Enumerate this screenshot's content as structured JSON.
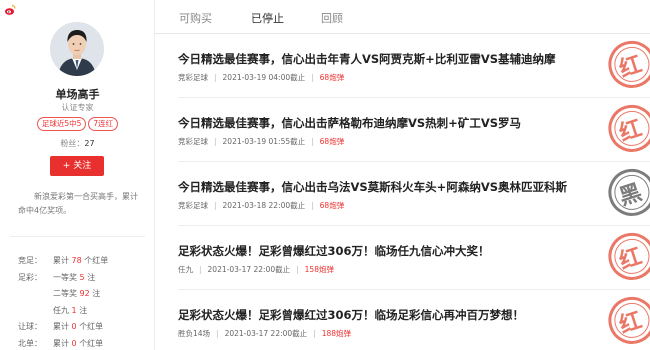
{
  "profile": {
    "name": "单场高手",
    "verify": "认证专家",
    "tags": [
      "足球近5中5",
      "7连红"
    ],
    "fans_label": "粉丝：",
    "fans_count": "27",
    "follow_label": "+ 关注",
    "bio": "新浪爱彩第一合买高手，累计命中4亿奖项。"
  },
  "stats": [
    {
      "label": "竞足：",
      "text": "累计",
      "num": "78",
      "unit": "个红单"
    },
    {
      "label": "足彩：",
      "text": "一等奖",
      "num": "5",
      "unit": "注"
    },
    {
      "label": "",
      "text": "二等奖",
      "num": "92",
      "unit": "注"
    },
    {
      "label": "",
      "text": "任九",
      "num": "1",
      "unit": "注"
    },
    {
      "label": "让球：",
      "text": "累计",
      "num": "0",
      "unit": "个红单"
    },
    {
      "label": "北单：",
      "text": "累计",
      "num": "0",
      "unit": "个红单"
    }
  ],
  "tabs": [
    "可购买",
    "已停止",
    "回顾"
  ],
  "active_tab": 1,
  "items": [
    {
      "title": "今日精选最佳赛事，信心出击年青人VS阿贾克斯+比利亚雷VS基辅迪纳摩",
      "type": "竞彩足球",
      "time": "2021-03-19 04:00截止",
      "price": "68炮弹",
      "stamp": "红",
      "stamp_color": "#e8604c"
    },
    {
      "title": "今日精选最佳赛事，信心出击萨格勒布迪纳摩VS热刺+矿工VS罗马",
      "type": "竞彩足球",
      "time": "2021-03-19 01:55截止",
      "price": "68炮弹",
      "stamp": "红",
      "stamp_color": "#e8604c"
    },
    {
      "title": "今日精选最佳赛事，信心出击乌法VS莫斯科火车头+阿森纳VS奥林匹亚科斯",
      "type": "竞彩足球",
      "time": "2021-03-18 22:00截止",
      "price": "68炮弹",
      "stamp": "黑",
      "stamp_color": "#666666"
    },
    {
      "title": "足彩状态火爆！足彩曾爆红过306万！临场任九信心冲大奖！",
      "type": "任九",
      "time": "2021-03-17 22:00截止",
      "price": "158炮弹",
      "stamp": "红",
      "stamp_color": "#e8604c"
    },
    {
      "title": "足彩状态火爆！足彩曾爆红过306万！临场足彩信心再冲百万梦想！",
      "type": "胜负14场",
      "time": "2021-03-17 22:00截止",
      "price": "188炮弹",
      "stamp": "红",
      "stamp_color": "#e8604c"
    }
  ]
}
